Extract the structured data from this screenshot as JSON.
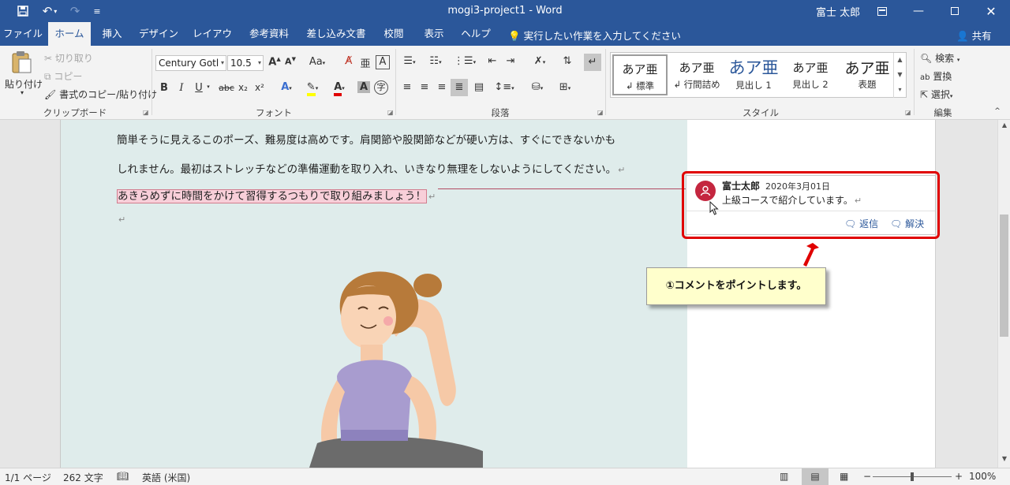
{
  "window": {
    "title": "mogi3-project1  -  Word",
    "user": "富士 太郎",
    "qat": {
      "save_icon": "save-icon",
      "undo_icon": "undo-icon",
      "redo_icon": "redo-icon"
    }
  },
  "tabs": [
    "ファイル",
    "ホーム",
    "挿入",
    "デザイン",
    "レイアウト",
    "参考資料",
    "差し込み文書",
    "校閲",
    "表示",
    "ヘルプ"
  ],
  "tell_me": "実行したい作業を入力してください",
  "share": "共有",
  "clipboard": {
    "paste": "貼り付け",
    "cut": "切り取り",
    "copy": "コピー",
    "format_painter": "書式のコピー/貼り付け",
    "label": "クリップボード"
  },
  "font": {
    "font_name": "Century Gotl",
    "font_size": "10.5",
    "label": "フォント",
    "buttons": {
      "bold": "B",
      "italic": "I",
      "underline": "U",
      "strike": "abc",
      "sub": "x₂",
      "sup": "x²",
      "grow": "A",
      "shrink": "A",
      "case": "Aa"
    }
  },
  "paragraph": {
    "label": "段落"
  },
  "styles": {
    "label": "スタイル",
    "items": [
      {
        "sample": "あア亜",
        "name": "↲ 標準"
      },
      {
        "sample": "あア亜",
        "name": "↲ 行間詰め"
      },
      {
        "sample": "あア亜",
        "name": "見出し 1"
      },
      {
        "sample": "あア亜",
        "name": "見出し 2"
      },
      {
        "sample": "あア亜",
        "name": "表題"
      }
    ]
  },
  "editing": {
    "find": "検索",
    "replace": "置換",
    "select": "選択",
    "label": "編集"
  },
  "document": {
    "lines": [
      "簡単そうに見えるこのポーズ、難易度は高めです。肩関節や股関節などが硬い方は、すぐにできないかも",
      "しれません。最初はストレッチなどの準備運動を取り入れ、いきなり無理をしないようにしてください。",
      "あきらめずに時間をかけて習得するつもりで取り組みましょう！"
    ],
    "para_mark": "↵"
  },
  "comment": {
    "author": "富士太郎",
    "date": "2020年3月01日",
    "text": "上級コースで紹介しています。",
    "reply": "返信",
    "resolve": "解決"
  },
  "callout": "①コメントをポイントします。",
  "status": {
    "page": "1/1 ページ",
    "words": "262 文字",
    "language": "英語 (米国)",
    "zoom": "100%"
  },
  "colors": {
    "title_bar": "#2b579a",
    "comment_avatar": "#c4263f",
    "highlight_frame": "#e00000",
    "comment_highlight": "#f8cfd9",
    "callout": "#ffffcc"
  }
}
